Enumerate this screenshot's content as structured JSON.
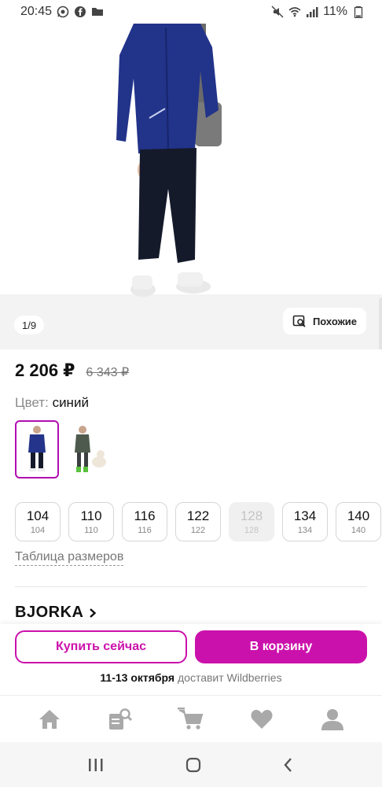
{
  "status": {
    "time": "20:45",
    "battery": "11%"
  },
  "gallery": {
    "counter": "1/9",
    "similar_label": "Похожие"
  },
  "product": {
    "price": "2 206 ₽",
    "old_price": "6 343 ₽",
    "color_label": "Цвет:",
    "color_value": "синий",
    "brand": "BJORKA"
  },
  "sizes": [
    {
      "ru": "104",
      "eu": "104",
      "available": true
    },
    {
      "ru": "110",
      "eu": "110",
      "available": true
    },
    {
      "ru": "116",
      "eu": "116",
      "available": true
    },
    {
      "ru": "122",
      "eu": "122",
      "available": true
    },
    {
      "ru": "128",
      "eu": "128",
      "available": false
    },
    {
      "ru": "134",
      "eu": "134",
      "available": true
    },
    {
      "ru": "140",
      "eu": "140",
      "available": true
    }
  ],
  "size_table_label": "Таблица размеров",
  "actions": {
    "buy_now": "Купить сейчас",
    "add_to_cart": "В корзину",
    "delivery_date": "11-13 октября",
    "delivery_text": "доставит Wildberries"
  },
  "colors": {
    "accent": "#cb11ab",
    "accent_border": "#b10eb1"
  },
  "tabs": [
    "home-icon",
    "catalog-search-icon",
    "cart-icon",
    "heart-icon",
    "profile-icon"
  ]
}
